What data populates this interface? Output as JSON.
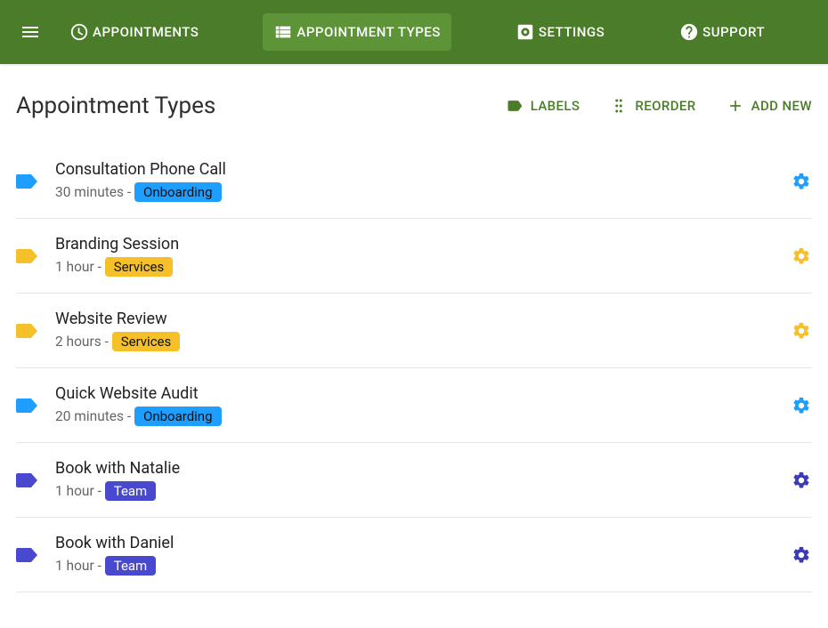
{
  "nav": {
    "items": [
      {
        "label": "APPOINTMENTS"
      },
      {
        "label": "APPOINTMENT TYPES"
      },
      {
        "label": "SETTINGS"
      },
      {
        "label": "SUPPORT"
      }
    ]
  },
  "page": {
    "title": "Appointment Types",
    "actions": {
      "labels": "LABELS",
      "reorder": "REORDER",
      "add_new": "ADD NEW"
    }
  },
  "items": [
    {
      "title": "Consultation Phone Call",
      "duration": "30 minutes",
      "label": "Onboarding",
      "label_key": "onboarding"
    },
    {
      "title": "Branding Session",
      "duration": "1 hour",
      "label": "Services",
      "label_key": "services"
    },
    {
      "title": "Website Review",
      "duration": "2 hours",
      "label": "Services",
      "label_key": "services"
    },
    {
      "title": "Quick Website Audit",
      "duration": "20 minutes",
      "label": "Onboarding",
      "label_key": "onboarding"
    },
    {
      "title": "Book with Natalie",
      "duration": "1 hour",
      "label": "Team",
      "label_key": "team"
    },
    {
      "title": "Book with Daniel",
      "duration": "1 hour",
      "label": "Team",
      "label_key": "team"
    }
  ],
  "colors": {
    "brand_green": "#4a7c2a",
    "nav_active": "#5d9438",
    "onboarding": "#1e9fff",
    "services": "#f5c029",
    "team": "#4949d0"
  }
}
